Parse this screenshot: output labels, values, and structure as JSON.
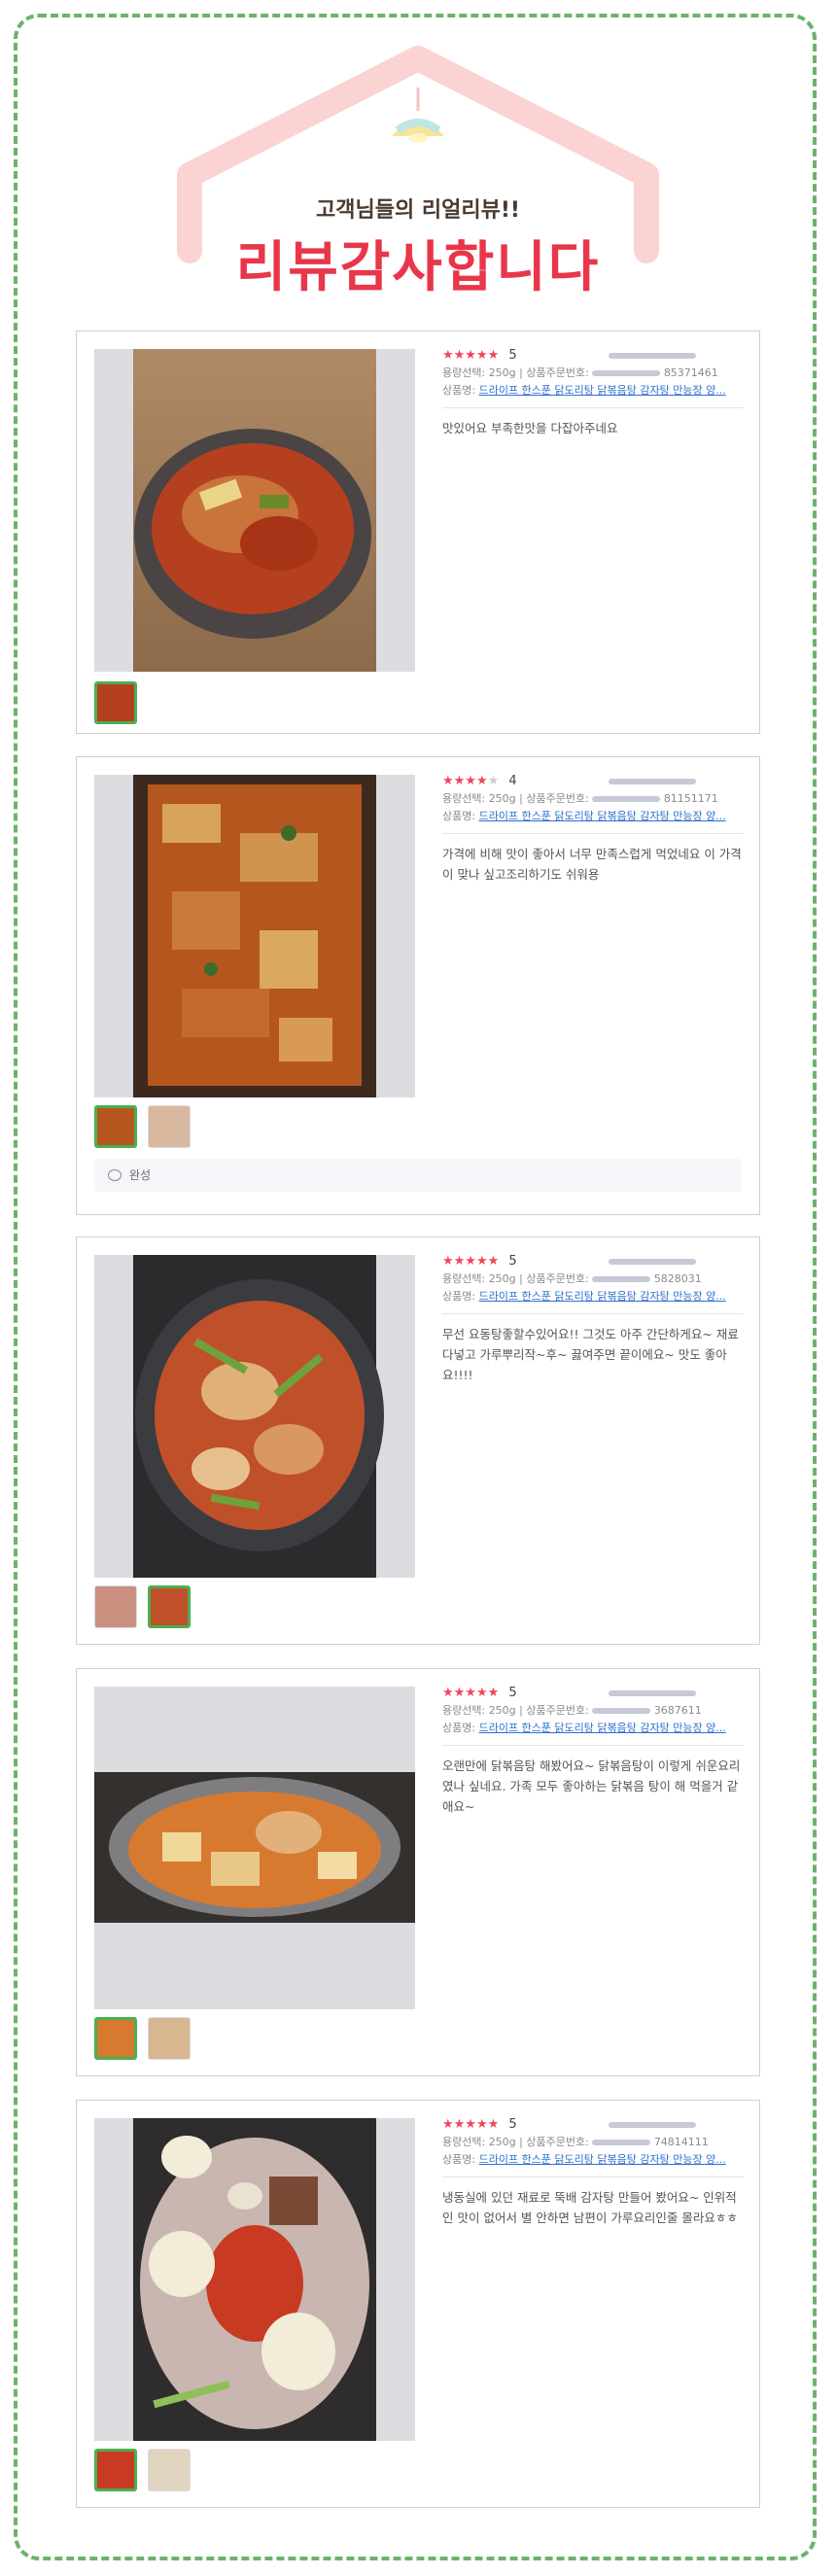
{
  "header": {
    "subtitle": "고객님들의 리얼리뷰!!",
    "title": "리뷰감사합니다"
  },
  "colors": {
    "frame_border": "#6bb36b",
    "title_red": "#e8364a",
    "roof_pink": "#fbd3d3",
    "star": "#f0455a",
    "link": "#2f6fcf",
    "thumb_selected": "#4caf50"
  },
  "labels": {
    "option_label": "용량선택:",
    "order_label": "상품주문번호:",
    "product_label": "상품명:",
    "product_name": "드라이프 한스푼 닭도리탕 닭볶음탕 감자탕 만능장 양..."
  },
  "reviews": [
    {
      "rating": "5",
      "stars": 5,
      "option": "250g",
      "order_tail": "85371461",
      "text": "맛있어요 부족한맛을 다잡아주네요",
      "photos": 1,
      "reply": ""
    },
    {
      "rating": "4",
      "stars": 4,
      "option": "250g",
      "order_tail": "81151171",
      "text": "가격에 비해 맛이 좋아서 너무 만족스럽게 먹었네요 이 가격이 맞나 싶고조리하기도 쉬워용",
      "photos": 2,
      "reply": "완성"
    },
    {
      "rating": "5",
      "stars": 5,
      "option": "250g",
      "order_tail": "5828031",
      "text": "무선 요동탕좋할수있어요!! 그것도 아주 간단하게요~ 재료 다넣고 가루뿌리작~후~ 끓여주면 끝이에요~ 맛도 좋아요!!!!",
      "photos": 2,
      "reply": ""
    },
    {
      "rating": "5",
      "stars": 5,
      "option": "250g",
      "order_tail": "3687611",
      "text": "오랜만에 닭볶음탕 해봤어요~ 닭볶음탕이 이렇게 쉬운요리였나 싶네요. 가족 모두 좋아하는 닭볶음 탕이 해 먹을거 같애요~",
      "photos": 2,
      "reply": ""
    },
    {
      "rating": "5",
      "stars": 5,
      "option": "250g",
      "order_tail": "74814111",
      "text": "냉동실에 있던 재료로 뚝배 감자탕 만들어 봤어요~ 인위적인 맛이 없어서 별 안하면 남편이 가루요리인줄 몰라요ㅎㅎ",
      "photos": 2,
      "reply": ""
    }
  ]
}
